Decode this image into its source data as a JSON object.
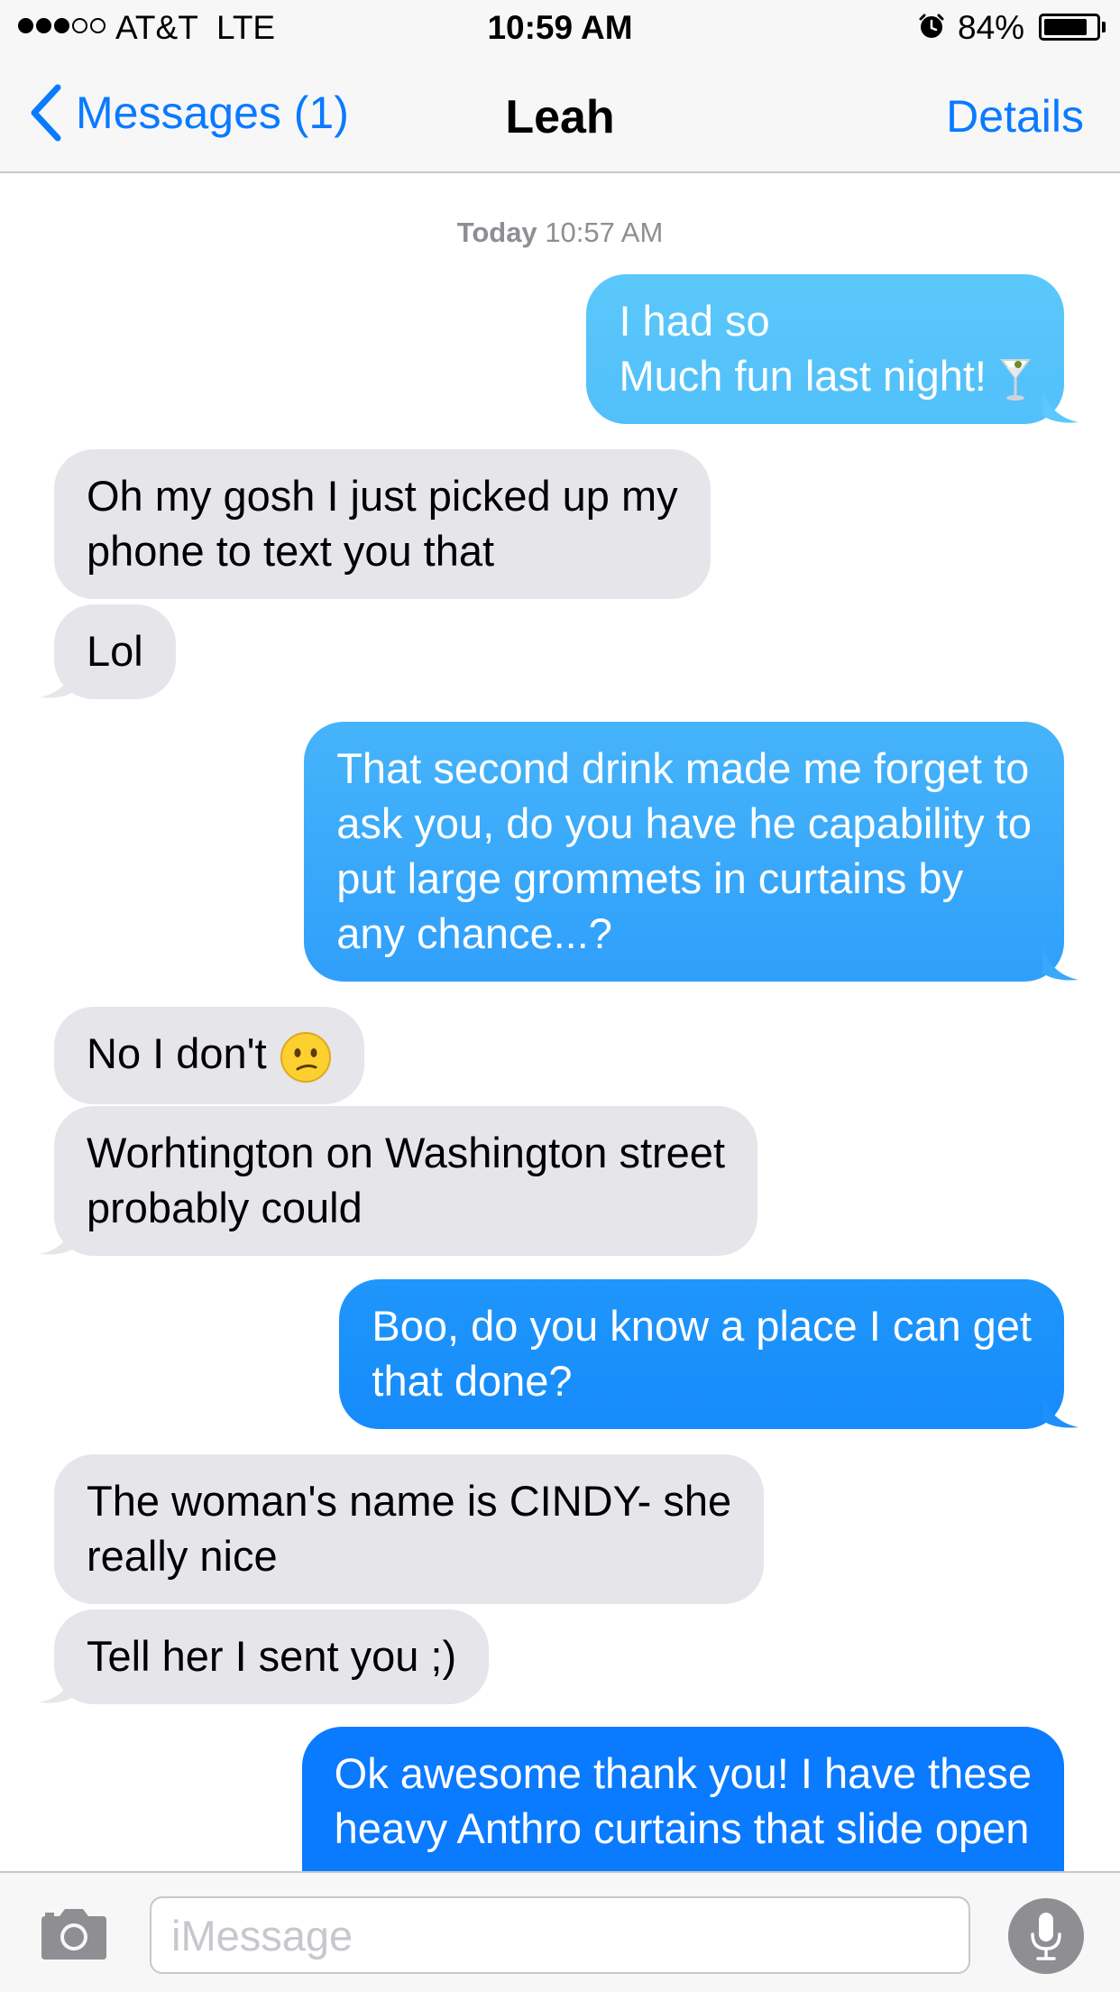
{
  "status_bar": {
    "carrier": "AT&T",
    "network": "LTE",
    "time": "10:59 AM",
    "battery": "84%",
    "battery_level": 0.84,
    "signal_bars": 3,
    "signal_max": 5,
    "icons": {
      "alarm": "alarm-clock-icon",
      "battery": "battery-icon"
    }
  },
  "nav": {
    "back_label": "Messages (1)",
    "title": "Leah",
    "details_label": "Details"
  },
  "thread": {
    "timestamp_day": "Today",
    "timestamp_time": "10:57 AM",
    "messages": [
      {
        "from": "me",
        "lines": [
          "I had so",
          "Much fun last night!"
        ],
        "emoji": "cocktail-glass"
      },
      {
        "from": "contact",
        "lines": [
          "Oh my gosh I just picked up my",
          "phone to text you that"
        ]
      },
      {
        "from": "contact",
        "lines": [
          "Lol"
        ]
      },
      {
        "from": "me",
        "lines": [
          "That second drink made me forget to",
          "ask you, do you have he capability to",
          "put large grommets in curtains by",
          "any chance...?"
        ]
      },
      {
        "from": "contact",
        "lines": [
          "No I don't"
        ],
        "emoji": "confused-face"
      },
      {
        "from": "contact",
        "lines": [
          "Worhtington on Washington street",
          "probably could"
        ]
      },
      {
        "from": "me",
        "lines": [
          "Boo, do you know a place I can get",
          "that done?"
        ]
      },
      {
        "from": "contact",
        "lines": [
          "The woman's name is CINDY- she",
          "really nice"
        ]
      },
      {
        "from": "contact",
        "lines": [
          "Tell her I sent you ;)"
        ]
      },
      {
        "from": "me",
        "lines": [
          "Ok awesome thank you! I have these",
          "heavy Anthro curtains that slide open"
        ]
      }
    ]
  },
  "input_bar": {
    "placeholder": "iMessage",
    "value": "",
    "icons": {
      "camera": "camera-icon",
      "mic": "microphone-icon"
    }
  },
  "colors": {
    "accent": "#0a7aff",
    "incoming_bubble": "#e5e5ea",
    "outgoing_gradient": [
      "#5ac8fa",
      "#1f96fb",
      "#0a7aff"
    ]
  }
}
